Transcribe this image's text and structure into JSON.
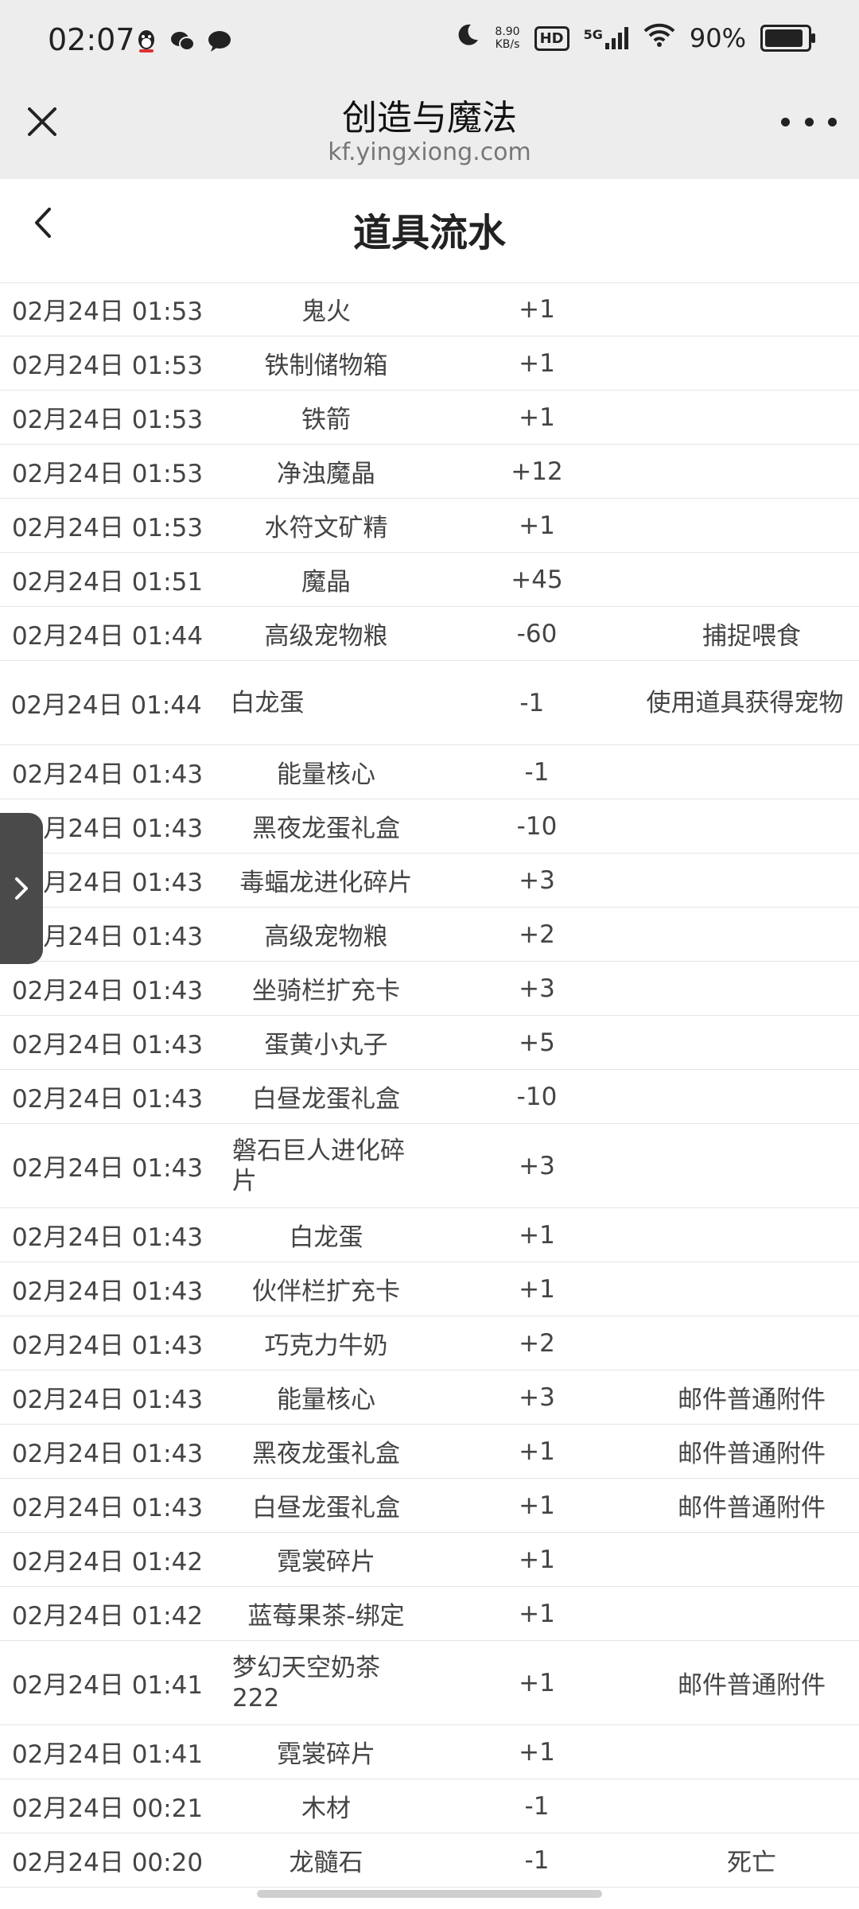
{
  "status": {
    "time": "02:07",
    "net_speed_value": "8.90",
    "net_speed_unit": "KB/s",
    "hd": "HD",
    "network": "5G",
    "battery": "90%",
    "battery_level": 0.9
  },
  "browser": {
    "title": "创造与魔法",
    "url": "kf.yingxiong.com"
  },
  "page": {
    "title": "道具流水"
  },
  "rows": [
    {
      "time": "02月24日 01:53",
      "item": "鬼火",
      "amount": "+1",
      "note": ""
    },
    {
      "time": "02月24日 01:53",
      "item": "铁制储物箱",
      "amount": "+1",
      "note": ""
    },
    {
      "time": "02月24日 01:53",
      "item": "铁箭",
      "amount": "+1",
      "note": ""
    },
    {
      "time": "02月24日 01:53",
      "item": "净浊魔晶",
      "amount": "+12",
      "note": ""
    },
    {
      "time": "02月24日 01:53",
      "item": "水符文矿精",
      "amount": "+1",
      "note": ""
    },
    {
      "time": "02月24日 01:51",
      "item": "魔晶",
      "amount": "+45",
      "note": ""
    },
    {
      "time": "02月24日 01:44",
      "item": "高级宠物粮",
      "amount": "-60",
      "note": "捕捉喂食"
    },
    {
      "time": "02月24日 01:44",
      "item": "白龙蛋",
      "amount": "-1",
      "note": "使用道具获得宠物",
      "tall": true,
      "note_multi": true
    },
    {
      "time": "02月24日 01:43",
      "item": "能量核心",
      "amount": "-1",
      "note": ""
    },
    {
      "time": "02月24日 01:43",
      "item": "黑夜龙蛋礼盒",
      "amount": "-10",
      "note": ""
    },
    {
      "time": "02月24日 01:43",
      "item": "毒蝠龙进化碎片",
      "amount": "+3",
      "note": ""
    },
    {
      "time": "02月24日 01:43",
      "item": "高级宠物粮",
      "amount": "+2",
      "note": ""
    },
    {
      "time": "02月24日 01:43",
      "item": "坐骑栏扩充卡",
      "amount": "+3",
      "note": ""
    },
    {
      "time": "02月24日 01:43",
      "item": "蛋黄小丸子",
      "amount": "+5",
      "note": ""
    },
    {
      "time": "02月24日 01:43",
      "item": "白昼龙蛋礼盒",
      "amount": "-10",
      "note": ""
    },
    {
      "time": "02月24日 01:43",
      "item": "磐石巨人进化碎片",
      "amount": "+3",
      "note": "",
      "tall": true
    },
    {
      "time": "02月24日 01:43",
      "item": "白龙蛋",
      "amount": "+1",
      "note": ""
    },
    {
      "time": "02月24日 01:43",
      "item": "伙伴栏扩充卡",
      "amount": "+1",
      "note": ""
    },
    {
      "time": "02月24日 01:43",
      "item": "巧克力牛奶",
      "amount": "+2",
      "note": ""
    },
    {
      "time": "02月24日 01:43",
      "item": "能量核心",
      "amount": "+3",
      "note": "邮件普通附件"
    },
    {
      "time": "02月24日 01:43",
      "item": "黑夜龙蛋礼盒",
      "amount": "+1",
      "note": "邮件普通附件"
    },
    {
      "time": "02月24日 01:43",
      "item": "白昼龙蛋礼盒",
      "amount": "+1",
      "note": "邮件普通附件"
    },
    {
      "time": "02月24日 01:42",
      "item": "霓裳碎片",
      "amount": "+1",
      "note": ""
    },
    {
      "time": "02月24日 01:42",
      "item": "蓝莓果茶-绑定",
      "amount": "+1",
      "note": ""
    },
    {
      "time": "02月24日 01:41",
      "item": "梦幻天空奶茶222",
      "amount": "+1",
      "note": "邮件普通附件",
      "tall": true
    },
    {
      "time": "02月24日 01:41",
      "item": "霓裳碎片",
      "amount": "+1",
      "note": ""
    },
    {
      "time": "02月24日 00:21",
      "item": "木材",
      "amount": "-1",
      "note": ""
    },
    {
      "time": "02月24日 00:20",
      "item": "龙髓石",
      "amount": "-1",
      "note": "死亡"
    }
  ]
}
